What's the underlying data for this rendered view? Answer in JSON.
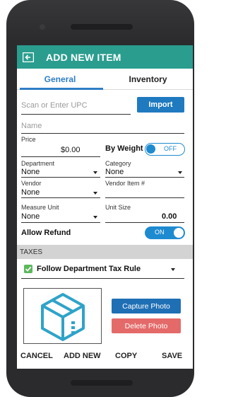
{
  "app_bar": {
    "title": "ADD NEW ITEM",
    "back_icon": "back-arrow-box-icon",
    "color": "#2a9d8f"
  },
  "tabs": [
    {
      "label": "General",
      "active": true
    },
    {
      "label": "Inventory",
      "active": false
    }
  ],
  "upc": {
    "placeholder": "Scan or Enter UPC",
    "import_label": "Import"
  },
  "name": {
    "placeholder": "Name"
  },
  "price": {
    "label": "Price",
    "value": "$0.00"
  },
  "by_weight": {
    "label": "By Weight",
    "state": "OFF"
  },
  "department": {
    "label": "Department",
    "value": "None"
  },
  "category": {
    "label": "Category",
    "value": "None"
  },
  "vendor": {
    "label": "Vendor",
    "value": "None"
  },
  "vendor_item": {
    "label": "Vendor Item #",
    "value": ""
  },
  "measure_unit": {
    "label": "Measure Unit",
    "value": "None"
  },
  "unit_size": {
    "label": "Unit Size",
    "value": "0.00"
  },
  "allow_refund": {
    "label": "Allow Refund",
    "state": "ON"
  },
  "taxes": {
    "header": "TAXES",
    "rule_label": "Follow Department Tax Rule",
    "checked": true
  },
  "photo": {
    "icon": "package-box-icon",
    "capture_label": "Capture Photo",
    "delete_label": "Delete Photo"
  },
  "actions": {
    "cancel": "CANCEL",
    "add_new": "ADD NEW",
    "copy": "COPY",
    "save": "SAVE"
  },
  "colors": {
    "accent_blue": "#1f7ac0",
    "teal": "#2a9d8f",
    "delete_red": "#e46a6a",
    "check_green": "#5cb85c"
  }
}
